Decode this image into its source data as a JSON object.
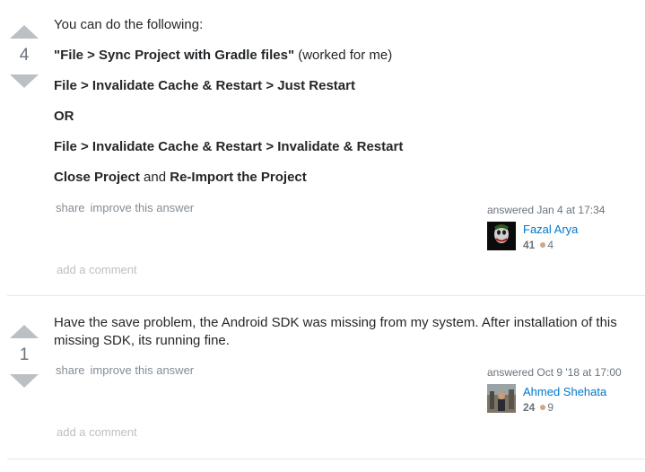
{
  "answers": [
    {
      "votes": "4",
      "paragraphs": [
        [
          {
            "t": "You can do the following:",
            "b": false
          }
        ],
        [
          {
            "t": "\"File > Sync Project with Gradle files\"",
            "b": true
          },
          {
            "t": " (worked for me)",
            "b": false
          }
        ],
        [
          {
            "t": "File > Invalidate Cache & Restart > Just Restart",
            "b": true
          }
        ],
        [
          {
            "t": "OR",
            "b": true
          }
        ],
        [
          {
            "t": "File > Invalidate Cache & Restart > Invalidate & Restart",
            "b": true
          }
        ],
        [
          {
            "t": "Close Project",
            "b": true
          },
          {
            "t": " and ",
            "b": false
          },
          {
            "t": "Re-Import the Project",
            "b": true
          }
        ]
      ],
      "menu": {
        "share": "share",
        "improve": "improve this answer"
      },
      "signature": {
        "action": "answered Jan 4 at 17:34",
        "user": "Fazal Arya",
        "reputation": "41",
        "bronze_badges": "4"
      },
      "add_comment": "add a comment"
    },
    {
      "votes": "1",
      "paragraphs": [
        [
          {
            "t": "Have the save problem, the Android SDK was missing from my system. After installation of this missing SDK, its running fine.",
            "b": false
          }
        ]
      ],
      "menu": {
        "share": "share",
        "improve": "improve this answer"
      },
      "signature": {
        "action": "answered Oct 9 '18 at 17:00",
        "user": "Ahmed Shehata",
        "reputation": "24",
        "bronze_badges": "9"
      },
      "add_comment": "add a comment"
    }
  ],
  "colors": {
    "link": "#0077cc",
    "muted": "#848d95",
    "arrow": "#bbc0c4",
    "bronze": "#d1a684"
  }
}
